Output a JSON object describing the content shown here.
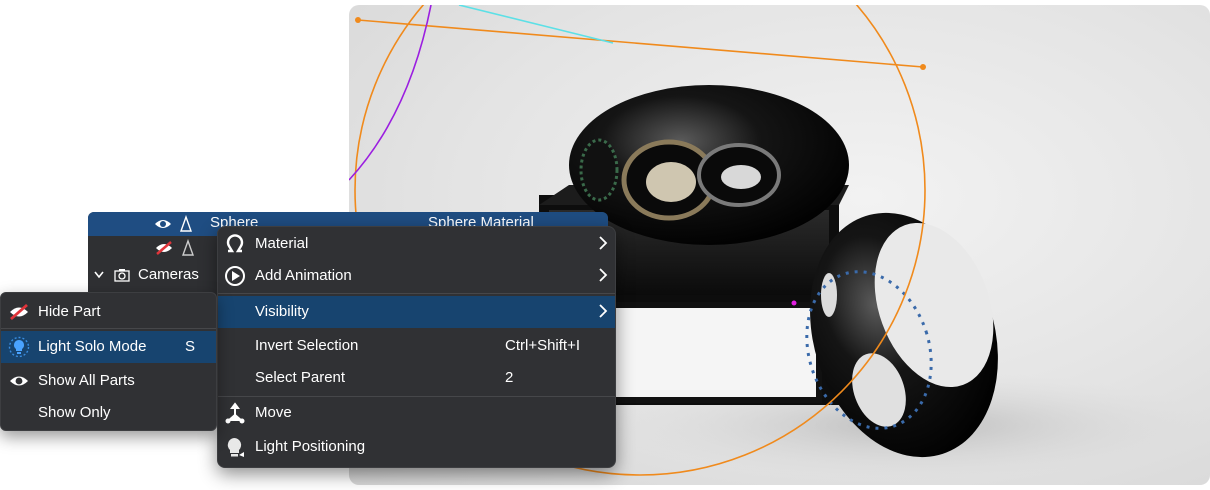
{
  "scene_tree": {
    "selected_item": "Sphere",
    "selected_material": "Sphere Material",
    "cameras_label": "Cameras"
  },
  "context_menu": {
    "items": [
      {
        "label": "Material",
        "shortcut": "",
        "submenu": true,
        "icon": "material-icon"
      },
      {
        "label": "Add Animation",
        "shortcut": "",
        "submenu": true,
        "icon": "add-animation-icon"
      },
      {
        "label": "Visibility",
        "shortcut": "",
        "submenu": true,
        "highlighted": true
      },
      {
        "label": "Invert Selection",
        "shortcut": "Ctrl+Shift+I"
      },
      {
        "label": "Select Parent",
        "shortcut": "2"
      },
      {
        "label": "Move",
        "shortcut": "",
        "icon": "move-icon"
      },
      {
        "label": "Light Positioning",
        "shortcut": "",
        "icon": "light-positioning-icon"
      }
    ]
  },
  "visibility_submenu": {
    "items": [
      {
        "label": "Hide Part",
        "shortcut": "",
        "icon": "hide-eye-icon"
      },
      {
        "label": "Light Solo Mode",
        "shortcut": "S",
        "icon": "bulb-icon",
        "highlighted": true
      },
      {
        "label": "Show All Parts",
        "shortcut": "",
        "icon": "eye-icon"
      },
      {
        "label": "Show Only",
        "shortcut": ""
      }
    ]
  },
  "colors": {
    "menu_bg": "#303134",
    "highlight": "#17446f",
    "selected_row": "#1f4d82",
    "light_gizmo": "#f08a1c",
    "axis_purple": "#9b1ee0",
    "axis_cyan": "#5ce0e6"
  }
}
